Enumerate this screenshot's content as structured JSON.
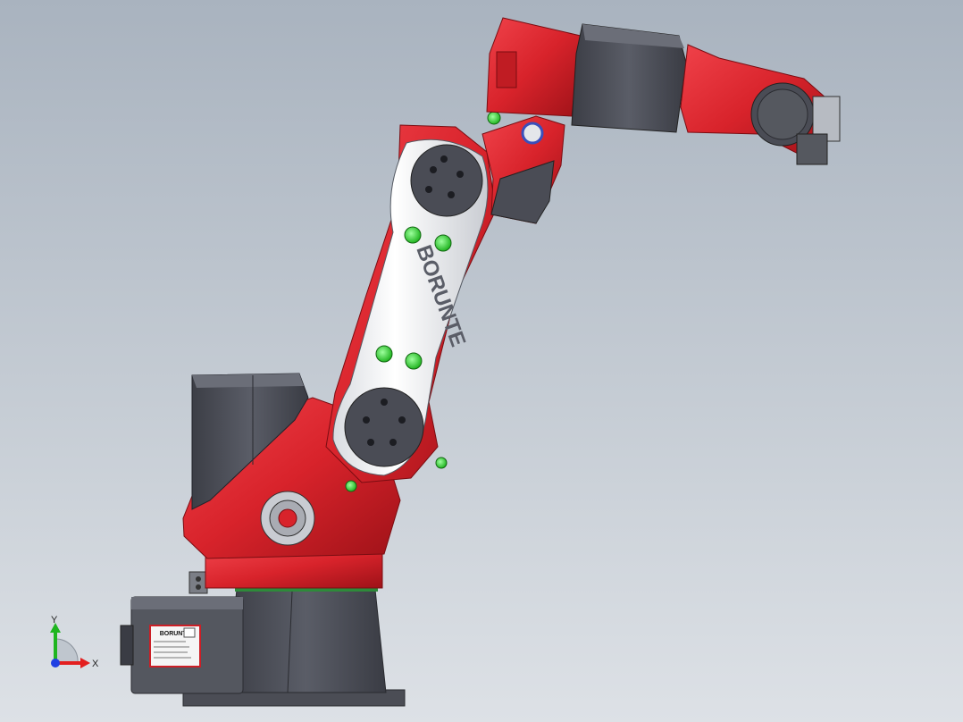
{
  "viewport": {
    "background_top": "#a9b3bf",
    "background_bottom": "#dde1e6"
  },
  "model": {
    "brand_text": "BORUNTE",
    "nameplate_title": "BORUNTE",
    "colors": {
      "red": "#d8232b",
      "red_dark": "#9e1218",
      "grey_dark": "#4a4c55",
      "grey_mid": "#6b6e78",
      "white": "#f2f3f5",
      "green": "#37d837"
    }
  },
  "triad": {
    "x_label": "X",
    "y_label": "Y",
    "x_color": "#e31f1f",
    "y_color": "#1fb51f",
    "z_color": "#1f3fe3"
  }
}
